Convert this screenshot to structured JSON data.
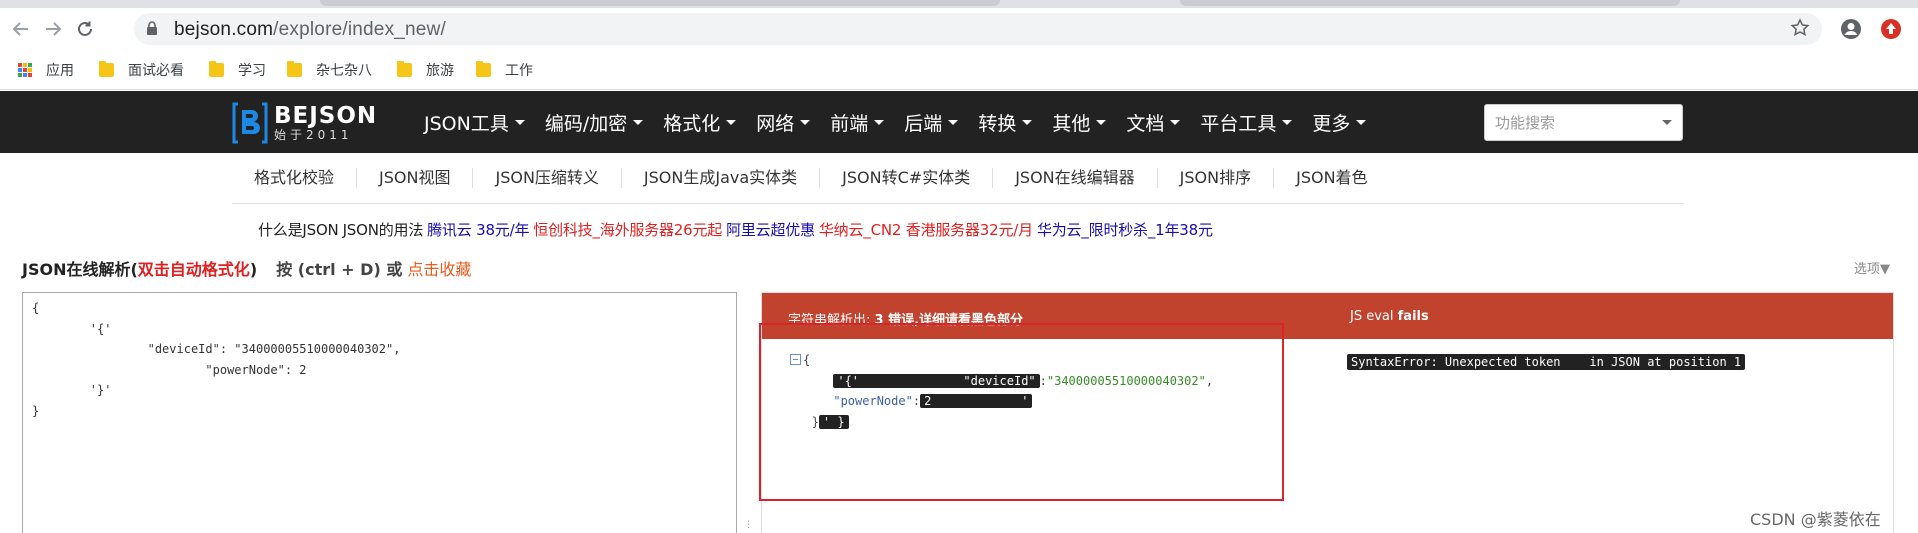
{
  "browser": {
    "url_host": "bejson.com",
    "url_path": "/explore/index_new/",
    "bookmarks": [
      {
        "label": "应用",
        "icon": "apps-grid-icon"
      },
      {
        "label": "面试必看",
        "icon": "folder-icon"
      },
      {
        "label": "学习",
        "icon": "folder-icon"
      },
      {
        "label": "杂七杂八",
        "icon": "folder-icon"
      },
      {
        "label": "旅游",
        "icon": "folder-icon"
      },
      {
        "label": "工作",
        "icon": "folder-icon"
      }
    ]
  },
  "site": {
    "logo_name": "BEJSON",
    "logo_tagline": "始于2011",
    "menu": [
      "JSON工具",
      "编码/加密",
      "格式化",
      "网络",
      "前端",
      "后端",
      "转换",
      "其他",
      "文档",
      "平台工具",
      "更多"
    ],
    "search_placeholder": "功能搜索",
    "subnav": [
      "格式化校验",
      "JSON视图",
      "JSON压缩转义",
      "JSON生成Java实体类",
      "JSON转C#实体类",
      "JSON在线编辑器",
      "JSON排序",
      "JSON着色"
    ],
    "ad_links": [
      {
        "text": "什么是JSON",
        "color": "#222222"
      },
      {
        "text": "JSON的用法",
        "color": "#222222"
      },
      {
        "text": "腾讯云 38元/年",
        "color": "#1a0dab"
      },
      {
        "text": "恒创科技_海外服务器26元起",
        "color": "#e02020"
      },
      {
        "text": "阿里云超优惠",
        "color": "#1a0dab"
      },
      {
        "text": "华纳云_CN2 香港服务器32元/月",
        "color": "#e02020"
      },
      {
        "text": "华为云_限时秒杀_1年38元",
        "color": "#1a0dab"
      }
    ]
  },
  "parser": {
    "title": "JSON在线解析(",
    "title_red": "双击自动格式化",
    "title_close": ")",
    "shortcut": "按 (ctrl + D) 或",
    "favorite": "点击收藏",
    "options": "选项▼",
    "input_text": "{\n\t'{'\n\t\t\"deviceId\": \"34000005510000040302\",\n\t\t\t\"powerNode\": 2\n\t'}'\n}",
    "result_header_prefix": "字符串解析出:",
    "result_header_bold": "3 错误,详细请看黑色部分",
    "eval_label": "JS eval",
    "eval_bold": "fails",
    "result": {
      "open_brace": "{",
      "line1_err": "'{'\t\t\"deviceId\"",
      "line1_colon": ":",
      "line1_value": "\"34000005510000040302\"",
      "line1_comma": ",",
      "line2_key": "\"powerNode\"",
      "line2_colon": ":",
      "line2_err": "2\t\t'",
      "line3_close": "}",
      "line3_err": "' }"
    },
    "eval_error": "SyntaxError: Unexpected token \t in JSON at position 1"
  },
  "watermark": "CSDN @紫菱依在"
}
